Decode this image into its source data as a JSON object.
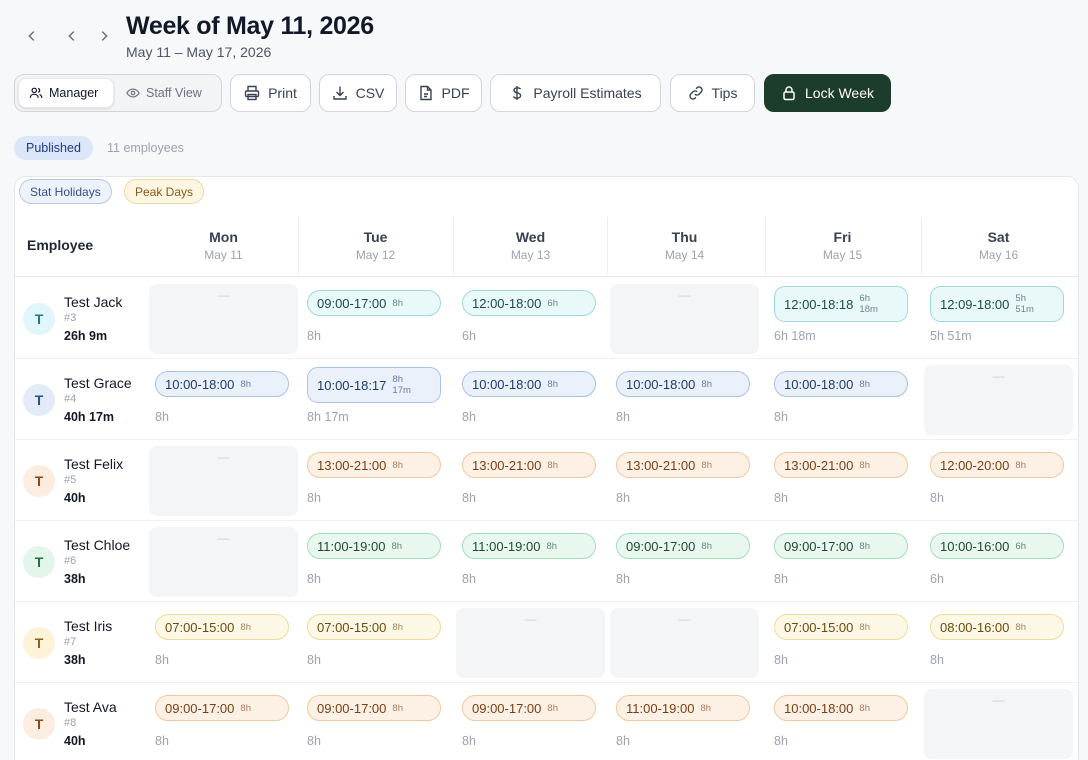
{
  "header": {
    "title": "Week of May 11, 2026",
    "subtitle": "May 11 – May 17, 2026"
  },
  "toolbar": {
    "manager_label": "Manager",
    "staff_view_label": "Staff View",
    "print_label": "Print",
    "csv_label": "CSV",
    "pdf_label": "PDF",
    "payroll_label": "Payroll Estimates",
    "tips_label": "Tips",
    "lock_label": "Lock Week"
  },
  "status": {
    "badge": "Published",
    "employee_count": "11 employees"
  },
  "filters": {
    "stat_holidays": "Stat Holidays",
    "peak_days": "Peak Days"
  },
  "grid": {
    "employee_header": "Employee",
    "days": [
      {
        "name": "Mon",
        "date": "May 11"
      },
      {
        "name": "Tue",
        "date": "May 12"
      },
      {
        "name": "Wed",
        "date": "May 13"
      },
      {
        "name": "Thu",
        "date": "May 14"
      },
      {
        "name": "Fri",
        "date": "May 15"
      },
      {
        "name": "Sat",
        "date": "May 16"
      }
    ],
    "empty_marker": "—",
    "employees": [
      {
        "initial": "T",
        "name": "Test Jack",
        "number": "#3",
        "total": "26h 9m",
        "avatar_bg": "#e0f6fa",
        "avatar_fg": "#1f7a88",
        "tone": "t-teal",
        "shifts": [
          null,
          {
            "time": "09:00-17:00",
            "dur": "8h",
            "hours": "8h"
          },
          {
            "time": "12:00-18:00",
            "dur": "6h",
            "hours": "6h"
          },
          null,
          {
            "time": "12:00-18:18",
            "dur": "6h",
            "dur2": "18m",
            "hours": "6h 18m"
          },
          {
            "time": "12:09-18:00",
            "dur": "5h",
            "dur2": "51m",
            "hours": "5h 51m"
          }
        ]
      },
      {
        "initial": "T",
        "name": "Test Grace",
        "number": "#4",
        "total": "40h 17m",
        "avatar_bg": "#e3ebf8",
        "avatar_fg": "#2b4f8c",
        "tone": "t-blue",
        "shifts": [
          {
            "time": "10:00-18:00",
            "dur": "8h",
            "hours": "8h"
          },
          {
            "time": "10:00-18:17",
            "dur": "8h",
            "dur2": "17m",
            "hours": "8h 17m"
          },
          {
            "time": "10:00-18:00",
            "dur": "8h",
            "hours": "8h"
          },
          {
            "time": "10:00-18:00",
            "dur": "8h",
            "hours": "8h"
          },
          {
            "time": "10:00-18:00",
            "dur": "8h",
            "hours": "8h"
          },
          null
        ]
      },
      {
        "initial": "T",
        "name": "Test Felix",
        "number": "#5",
        "total": "40h",
        "avatar_bg": "#fbeee0",
        "avatar_fg": "#8a4a18",
        "tone": "t-orange",
        "shifts": [
          null,
          {
            "time": "13:00-21:00",
            "dur": "8h",
            "hours": "8h"
          },
          {
            "time": "13:00-21:00",
            "dur": "8h",
            "hours": "8h"
          },
          {
            "time": "13:00-21:00",
            "dur": "8h",
            "hours": "8h"
          },
          {
            "time": "13:00-21:00",
            "dur": "8h",
            "hours": "8h"
          },
          {
            "time": "12:00-20:00",
            "dur": "8h",
            "hours": "8h"
          }
        ]
      },
      {
        "initial": "T",
        "name": "Test Chloe",
        "number": "#6",
        "total": "38h",
        "avatar_bg": "#e2f6ea",
        "avatar_fg": "#23704a",
        "tone": "t-green",
        "shifts": [
          null,
          {
            "time": "11:00-19:00",
            "dur": "8h",
            "hours": "8h"
          },
          {
            "time": "11:00-19:00",
            "dur": "8h",
            "hours": "8h"
          },
          {
            "time": "09:00-17:00",
            "dur": "8h",
            "hours": "8h"
          },
          {
            "time": "09:00-17:00",
            "dur": "8h",
            "hours": "8h"
          },
          {
            "time": "10:00-16:00",
            "dur": "6h",
            "hours": "6h"
          }
        ]
      },
      {
        "initial": "T",
        "name": "Test Iris",
        "number": "#7",
        "total": "38h",
        "avatar_bg": "#fcf3d9",
        "avatar_fg": "#8a6214",
        "tone": "t-yellow",
        "shifts": [
          {
            "time": "07:00-15:00",
            "dur": "8h",
            "hours": "8h"
          },
          {
            "time": "07:00-15:00",
            "dur": "8h",
            "hours": "8h"
          },
          null,
          null,
          {
            "time": "07:00-15:00",
            "dur": "8h",
            "hours": "8h"
          },
          {
            "time": "08:00-16:00",
            "dur": "8h",
            "hours": "8h"
          }
        ]
      },
      {
        "initial": "T",
        "name": "Test Ava",
        "number": "#8",
        "total": "40h",
        "avatar_bg": "#fbeee0",
        "avatar_fg": "#8a4a18",
        "tone": "t-orange",
        "shifts": [
          {
            "time": "09:00-17:00",
            "dur": "8h",
            "hours": "8h"
          },
          {
            "time": "09:00-17:00",
            "dur": "8h",
            "hours": "8h"
          },
          {
            "time": "09:00-17:00",
            "dur": "8h",
            "hours": "8h"
          },
          {
            "time": "11:00-19:00",
            "dur": "8h",
            "hours": "8h"
          },
          {
            "time": "10:00-18:00",
            "dur": "8h",
            "hours": "8h"
          },
          null
        ]
      }
    ]
  }
}
